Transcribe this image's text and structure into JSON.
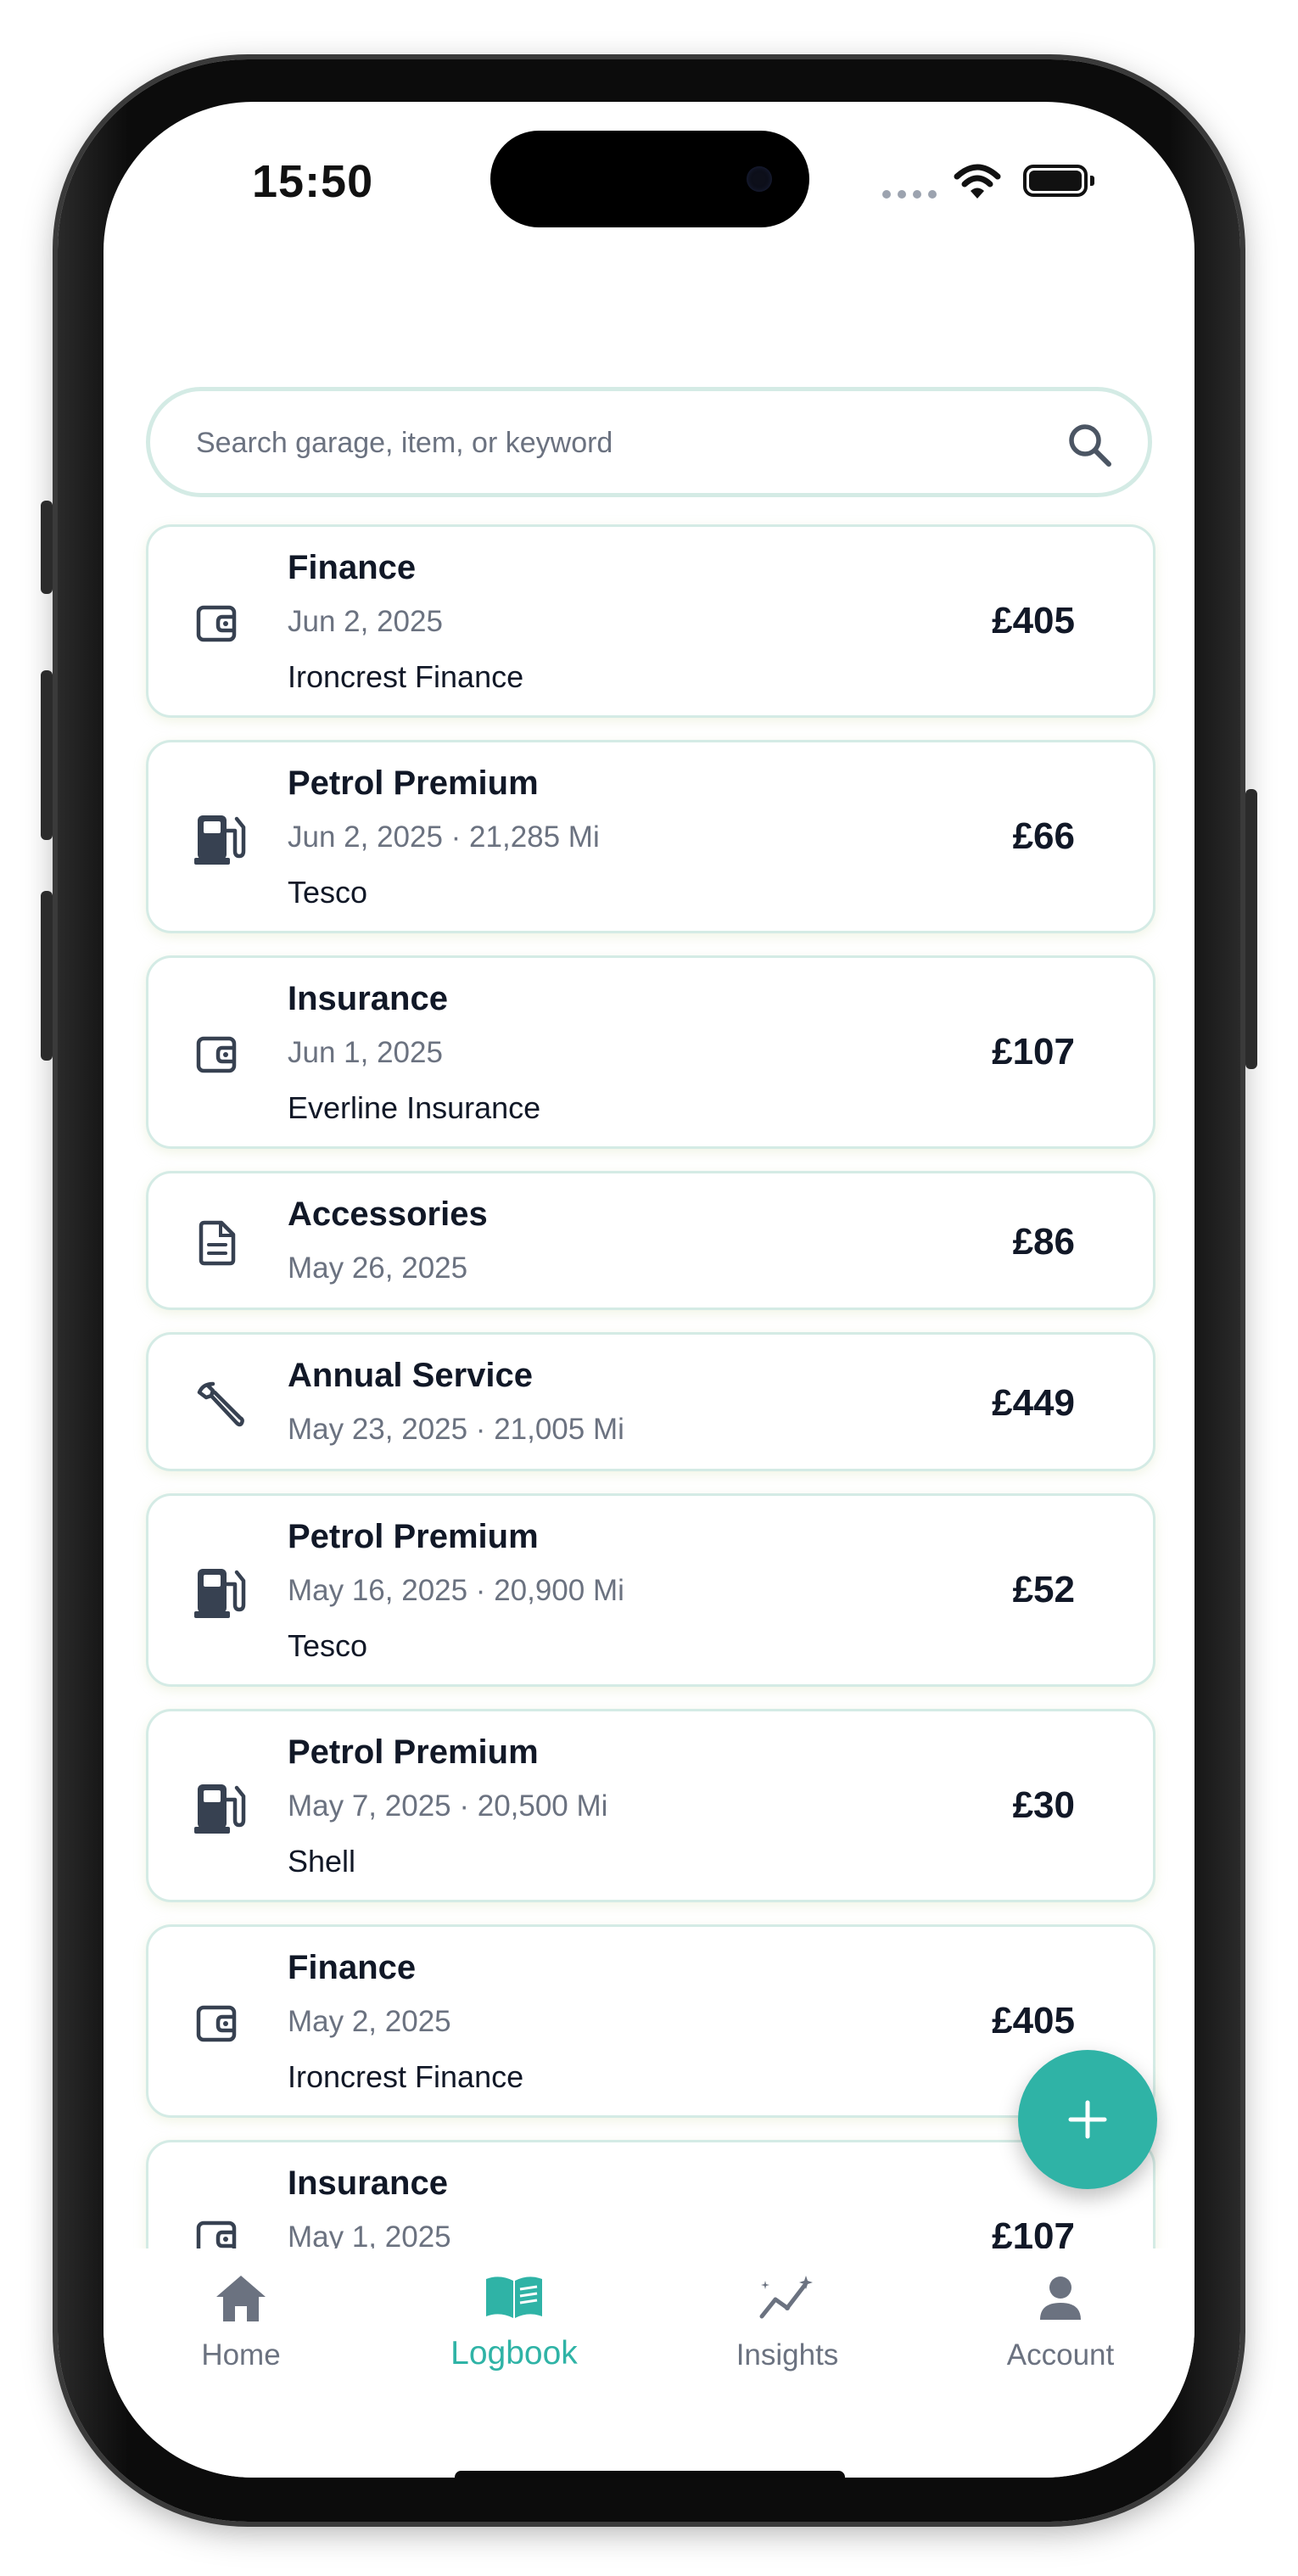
{
  "status_bar": {
    "time": "15:50"
  },
  "search": {
    "placeholder": "Search garage, item, or keyword"
  },
  "entries": [
    {
      "icon": "wallet-icon",
      "title": "Finance",
      "meta": "Jun 2, 2025",
      "vendor": "Ironcrest Finance",
      "amount": "£405"
    },
    {
      "icon": "fuel-pump-icon",
      "title": "Petrol Premium",
      "meta": "Jun 2, 2025 · 21,285 Mi",
      "vendor": "Tesco",
      "amount": "£66"
    },
    {
      "icon": "wallet-icon",
      "title": "Insurance",
      "meta": "Jun 1, 2025",
      "vendor": "Everline Insurance",
      "amount": "£107"
    },
    {
      "icon": "document-icon",
      "title": "Accessories",
      "meta": "May 26, 2025",
      "vendor": "",
      "amount": "£86"
    },
    {
      "icon": "wrench-icon",
      "title": "Annual Service",
      "meta": "May 23, 2025 · 21,005 Mi",
      "vendor": "",
      "amount": "£449"
    },
    {
      "icon": "fuel-pump-icon",
      "title": "Petrol Premium",
      "meta": "May 16, 2025 · 20,900 Mi",
      "vendor": "Tesco",
      "amount": "£52"
    },
    {
      "icon": "fuel-pump-icon",
      "title": "Petrol Premium",
      "meta": "May 7, 2025 · 20,500 Mi",
      "vendor": "Shell",
      "amount": "£30"
    },
    {
      "icon": "wallet-icon",
      "title": "Finance",
      "meta": "May 2, 2025",
      "vendor": "Ironcrest Finance",
      "amount": "£405"
    },
    {
      "icon": "wallet-icon",
      "title": "Insurance",
      "meta": "May 1, 2025",
      "vendor": "",
      "amount": "£107"
    }
  ],
  "fab": {
    "icon": "plus-icon"
  },
  "tabbar": {
    "items": [
      {
        "label": "Home",
        "icon": "home-icon",
        "active": false
      },
      {
        "label": "Logbook",
        "icon": "logbook-icon",
        "active": true
      },
      {
        "label": "Insights",
        "icon": "insights-icon",
        "active": false
      },
      {
        "label": "Account",
        "icon": "account-icon",
        "active": false
      }
    ]
  },
  "colors": {
    "accent": "#2fb3a6",
    "card_border": "#d4ebe5",
    "text": "#111827",
    "muted": "#6b7280"
  }
}
